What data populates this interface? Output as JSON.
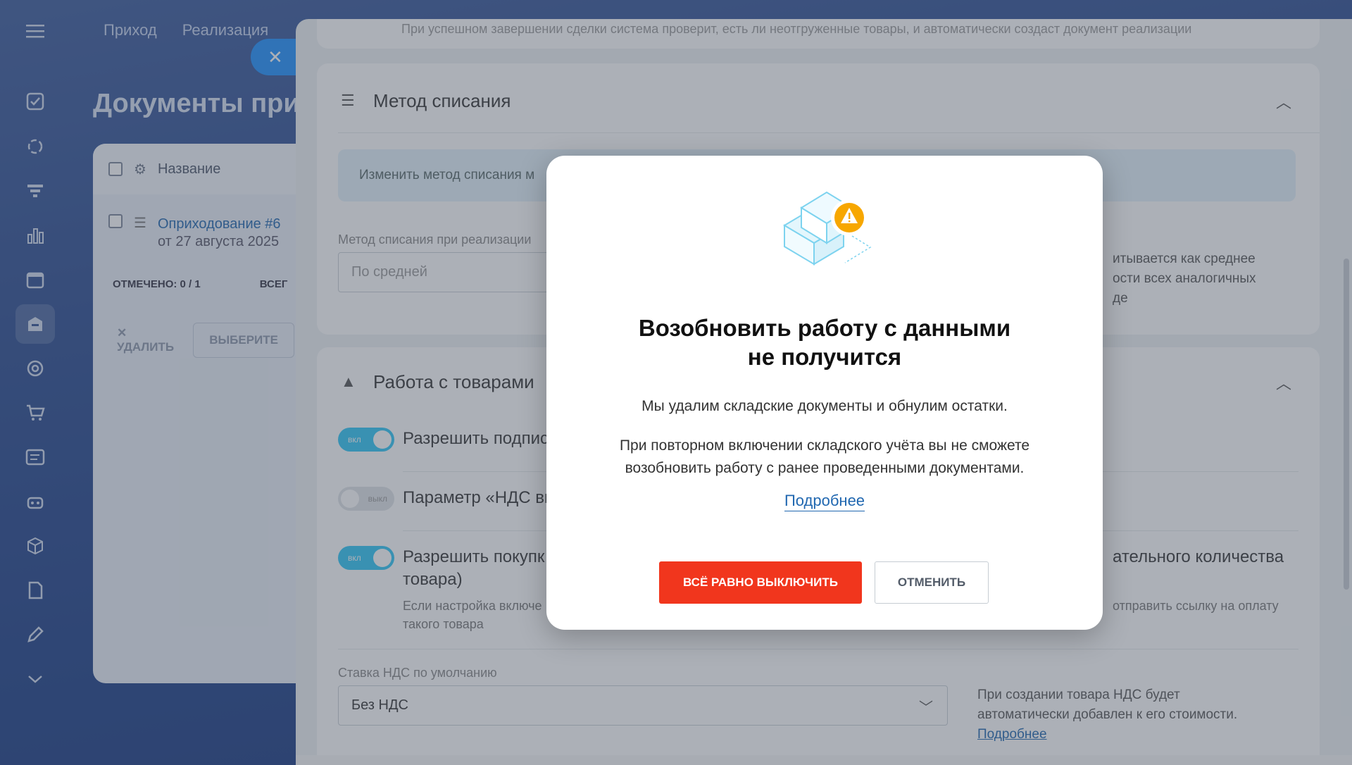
{
  "background": {
    "topnav": [
      "Приход",
      "Реализация"
    ],
    "page_title": "Документы при",
    "table_header": "Название",
    "row_link": "Оприходование #6",
    "row_date": "от 27 августа 2025",
    "footer_marked_label": "ОТМЕЧЕНО: 0 / 1",
    "footer_total_label": "ВСЕГ",
    "delete_label": "УДАЛИТЬ",
    "select_label": "ВЫБЕРИТЕ"
  },
  "slider": {
    "top_text": "При успешном завершении сделки система проверит, есть ли неотгруженные товары, и автоматически создаст документ реализации",
    "method_section": {
      "title": "Метод списания",
      "info": "Изменить метод списания м",
      "field_label": "Метод списания при реализации",
      "field_value": "По средней",
      "hint": "итывается как среднее\nости всех аналогичных\nде"
    },
    "goods_section": {
      "title": "Работа с товарами",
      "toggle_on": "вкл",
      "toggle_off": "выкл",
      "option1": "Разрешить подпис",
      "option2": "Параметр «НДС вк",
      "option3_line1": "Разрешить покупк",
      "option3_right": "ательного количества",
      "option3_line2": "товара)",
      "option3_desc1": "Если настройка включе",
      "option3_desc2": "такого товара",
      "option3_desc_right": "отправить ссылку на оплату",
      "vat_label": "Ставка НДС по умолчанию",
      "vat_value": "Без НДС",
      "vat_hint1": "При создании товара НДС будет",
      "vat_hint2": "автоматически добавлен к его стоимости.",
      "vat_more": "Подробнее"
    }
  },
  "modal": {
    "title_line1": "Возобновить работу с данными",
    "title_line2": "не получится",
    "text1": "Мы удалим складские документы и обнулим остатки.",
    "text2": "При повторном включении складского учёта вы не сможете возобновить работу с ранее проведенными документами.",
    "more_link": "Подробнее",
    "confirm_button": "ВСЁ РАВНО ВЫКЛЮЧИТЬ",
    "cancel_button": "ОТМЕНИТЬ"
  },
  "colors": {
    "danger": "#f1361d",
    "link": "#2067b0",
    "toggle_on": "#2fc6f6",
    "warning": "#f7a700"
  }
}
